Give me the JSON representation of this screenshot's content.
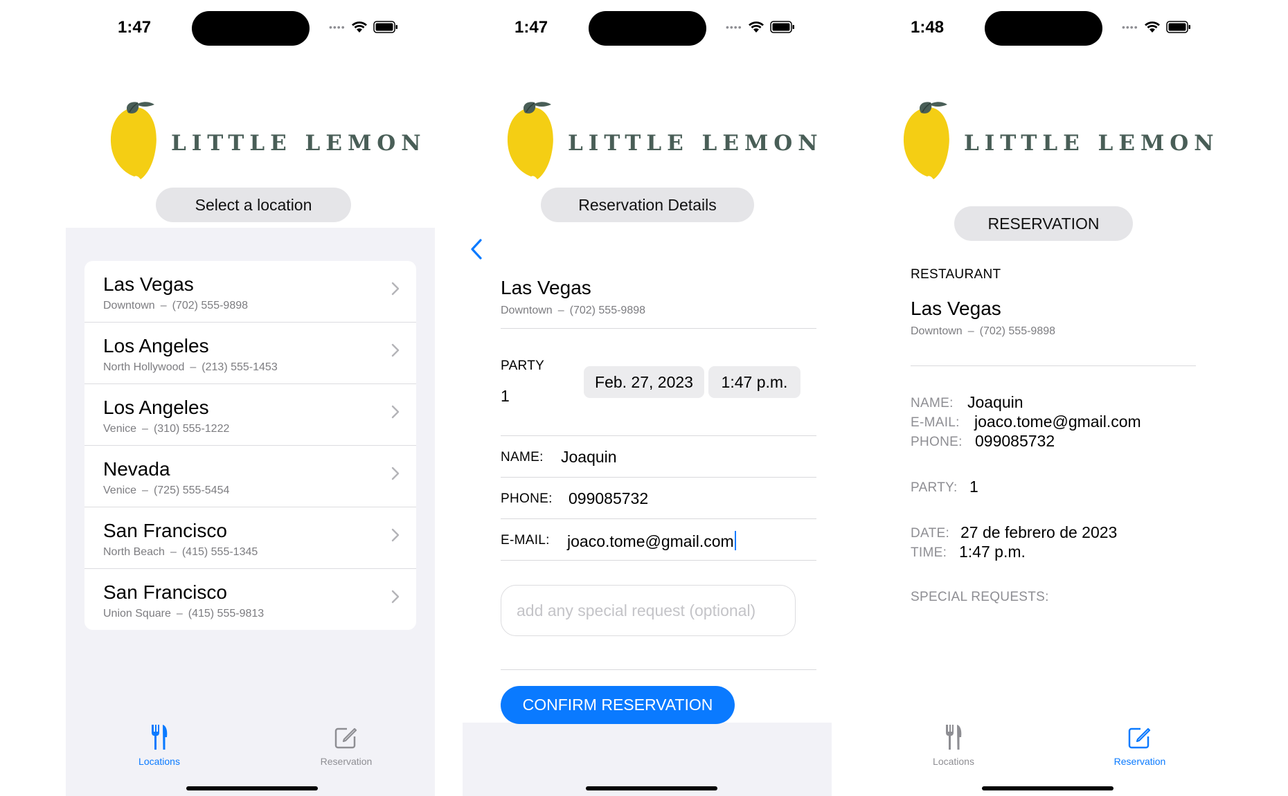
{
  "brand": {
    "name": "LITTLE LEMON"
  },
  "colors": {
    "accent": "#0a7aff",
    "brand_green": "#495e57",
    "lemon": "#f4ce14"
  },
  "screens": [
    {
      "status": {
        "time": "1:47"
      },
      "header": "Select a location",
      "locations": [
        {
          "city": "Las Vegas",
          "neighborhood": "Downtown",
          "phone": "(702) 555-9898"
        },
        {
          "city": "Los Angeles",
          "neighborhood": "North Hollywood",
          "phone": "(213) 555-1453"
        },
        {
          "city": "Los Angeles",
          "neighborhood": "Venice",
          "phone": "(310) 555-1222"
        },
        {
          "city": "Nevada",
          "neighborhood": "Venice",
          "phone": "(725) 555-5454"
        },
        {
          "city": "San Francisco",
          "neighborhood": "North Beach",
          "phone": "(415) 555-1345"
        },
        {
          "city": "San Francisco",
          "neighborhood": "Union Square",
          "phone": "(415) 555-9813"
        }
      ],
      "tabs": [
        {
          "label": "Locations",
          "icon": "fork-knife-icon",
          "active": true
        },
        {
          "label": "Reservation",
          "icon": "square-pencil-icon",
          "active": false
        }
      ]
    },
    {
      "status": {
        "time": "1:47"
      },
      "header": "Reservation Details",
      "restaurant": {
        "city": "Las Vegas",
        "neighborhood": "Downtown",
        "phone": "(702) 555-9898"
      },
      "party_label": "PARTY",
      "party_value": "1",
      "date": "Feb. 27, 2023",
      "time": "1:47 p.m.",
      "name_label": "NAME:",
      "name_value": "Joaquin",
      "phone_label": "PHONE:",
      "phone_value": "099085732",
      "email_label": "E-MAIL:",
      "email_value": "joaco.tome@gmail.com",
      "special_placeholder": "add any special request (optional)",
      "confirm_label": "CONFIRM RESERVATION"
    },
    {
      "status": {
        "time": "1:48"
      },
      "header": "RESERVATION",
      "restaurant_label": "RESTAURANT",
      "restaurant": {
        "city": "Las Vegas",
        "neighborhood": "Downtown",
        "phone": "(702) 555-9898"
      },
      "name_label": "NAME:",
      "name_value": "Joaquin",
      "email_label": "E-MAIL:",
      "email_value": "joaco.tome@gmail.com",
      "phone_label": "PHONE:",
      "phone_value": "099085732",
      "party_label": "PARTY:",
      "party_value": "1",
      "date_label": "DATE:",
      "date_value": "27 de febrero de 2023",
      "time_label": "TIME:",
      "time_value": "1:47 p.m.",
      "special_label": "SPECIAL REQUESTS:",
      "tabs": [
        {
          "label": "Locations",
          "icon": "fork-knife-icon",
          "active": false
        },
        {
          "label": "Reservation",
          "icon": "square-pencil-icon",
          "active": true
        }
      ]
    }
  ]
}
